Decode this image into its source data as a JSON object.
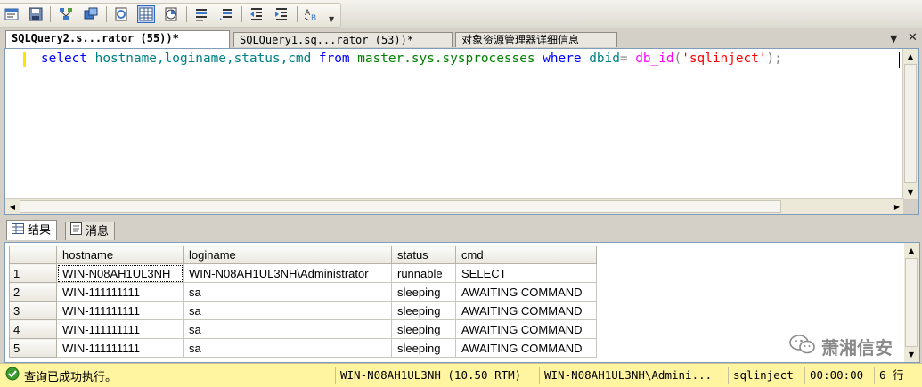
{
  "toolbar": {
    "buttons": [
      "results-to-text-icon",
      "results-to-file-icon",
      "execute-plan-icon",
      "query-options-icon",
      "include-plan-icon",
      "results-to-grid-icon",
      "client-statistics-icon",
      "comment-icon",
      "uncomment-icon",
      "decrease-indent-icon",
      "increase-indent-icon",
      "specify-values-icon"
    ]
  },
  "tabs": [
    {
      "label": "SQLQuery2.s...rator (55))*",
      "active": true
    },
    {
      "label": "SQLQuery1.sq...rator (53))*",
      "active": false
    },
    {
      "label": "对象资源管理器详细信息",
      "active": false
    }
  ],
  "editor": {
    "sql": {
      "kw_select": "select",
      "cols": "hostname,loginame,status,cmd",
      "kw_from": "from",
      "source": "master.sys.sysprocesses",
      "kw_where": "where",
      "col_dbid": "dbid",
      "op_eq": "=",
      "fn": "db_id",
      "paren_open": "(",
      "str": "'sqlinject'",
      "paren_close": ")",
      "semicolon": ";"
    }
  },
  "results_tabs": [
    {
      "label": "结果",
      "active": true
    },
    {
      "label": "消息",
      "active": false
    }
  ],
  "grid": {
    "columns": [
      "hostname",
      "loginame",
      "status",
      "cmd"
    ],
    "rows": [
      {
        "num": "1",
        "cells": [
          "WIN-N08AH1UL3NH",
          "WIN-N08AH1UL3NH\\Administrator",
          "runnable",
          "SELECT"
        ]
      },
      {
        "num": "2",
        "cells": [
          "WIN-111111111",
          "sa",
          "sleeping",
          "AWAITING COMMAND"
        ]
      },
      {
        "num": "3",
        "cells": [
          "WIN-111111111",
          "sa",
          "sleeping",
          "AWAITING COMMAND"
        ]
      },
      {
        "num": "4",
        "cells": [
          "WIN-111111111",
          "sa",
          "sleeping",
          "AWAITING COMMAND"
        ]
      },
      {
        "num": "5",
        "cells": [
          "WIN-111111111",
          "sa",
          "sleeping",
          "AWAITING COMMAND"
        ]
      }
    ]
  },
  "watermark": {
    "text": "萧湘信安"
  },
  "status": {
    "message": "查询已成功执行。",
    "server": "WIN-N08AH1UL3NH (10.50 RTM)",
    "user": "WIN-N08AH1UL3NH\\Admini...",
    "database": "sqlinject",
    "elapsed": "00:00:00",
    "rows": "6 行"
  },
  "colors": {
    "status_bg": "#fff5a0",
    "keyword": "#0000ff",
    "identifier": "#008080",
    "function": "#ff00ff",
    "string": "#ff0000"
  }
}
